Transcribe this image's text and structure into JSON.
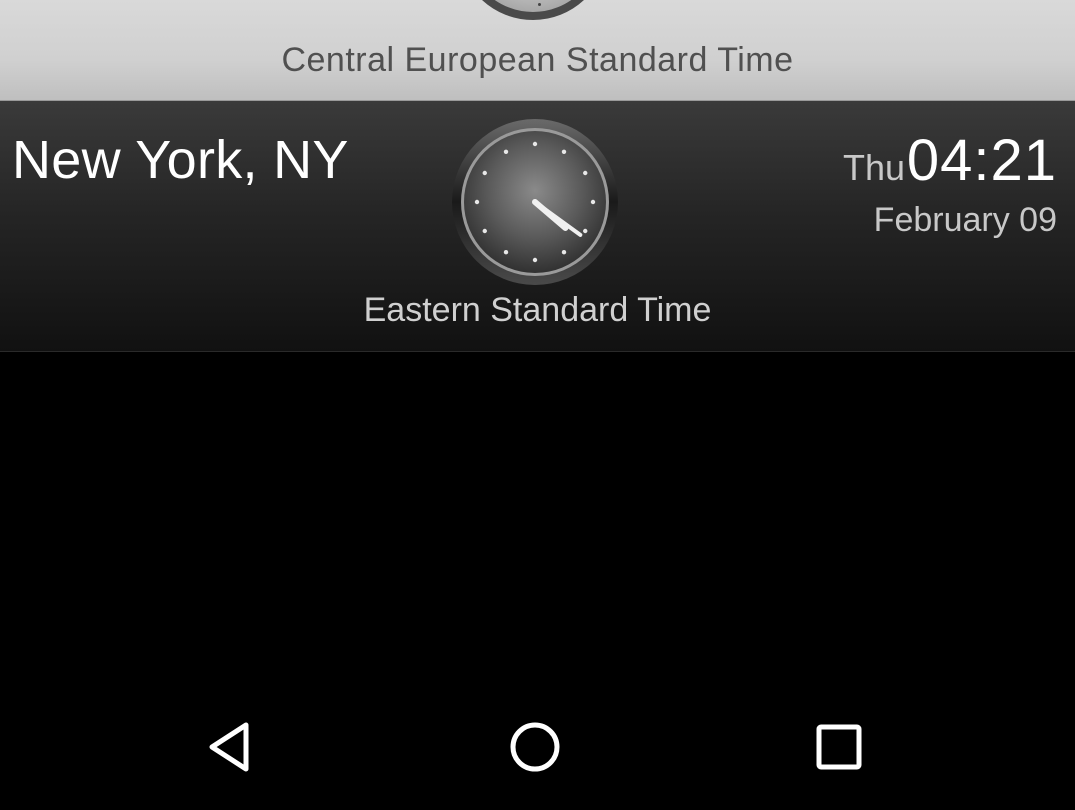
{
  "rows": [
    {
      "timezone": "Central European Standard Time"
    },
    {
      "city": "New York, NY",
      "day": "Thu",
      "time": "04:21",
      "date": "February 09",
      "timezone": "Eastern Standard Time",
      "clock": {
        "hour": 4,
        "minute": 21
      }
    }
  ],
  "navigation": {
    "back_icon": "triangle-back-icon",
    "home_icon": "circle-home-icon",
    "recents_icon": "square-recents-icon"
  },
  "colors": {
    "background": "#000000",
    "light_row": "#d0d0d0",
    "dark_row": "#252525",
    "text_primary": "#ffffff",
    "text_secondary": "#c8c8c8"
  }
}
